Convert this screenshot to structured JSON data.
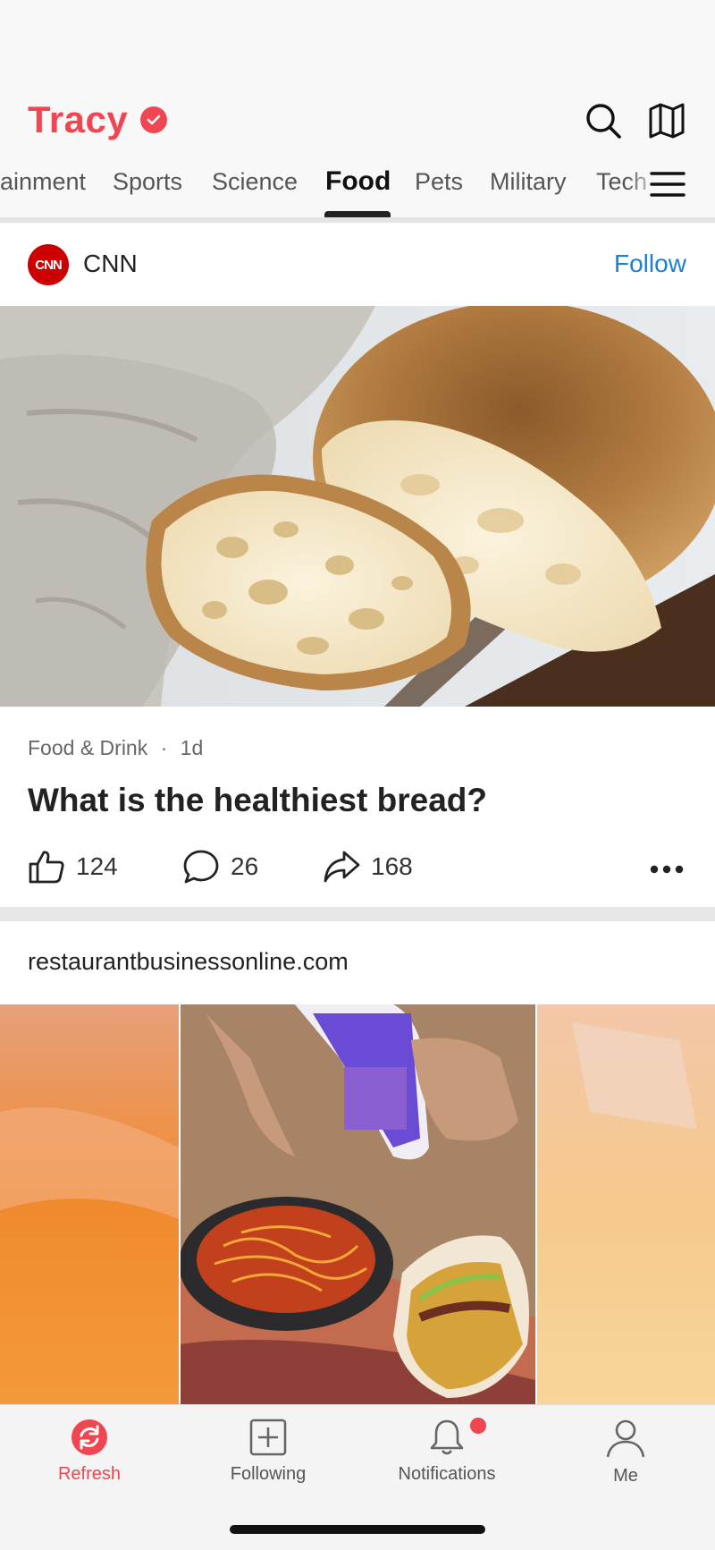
{
  "app": {
    "brand": "Tracy",
    "accent": "#ef4651",
    "link_color": "#1a7fd6"
  },
  "tabs": [
    "ainment",
    "Sports",
    "Science",
    "Food",
    "Pets",
    "Military",
    "Tech"
  ],
  "active_tab": "Food",
  "card1": {
    "source": "CNN",
    "source_logo": "CNN",
    "follow": "Follow",
    "category": "Food & Drink",
    "dot": "·",
    "age": "1d",
    "headline": "What is the healthiest bread?",
    "likes": "124",
    "comments": "26",
    "shares": "168"
  },
  "card2": {
    "domain": "restaurantbusinessonline.com"
  },
  "nav": {
    "refresh": "Refresh",
    "following": "Following",
    "notifications": "Notifications",
    "me": "Me"
  }
}
